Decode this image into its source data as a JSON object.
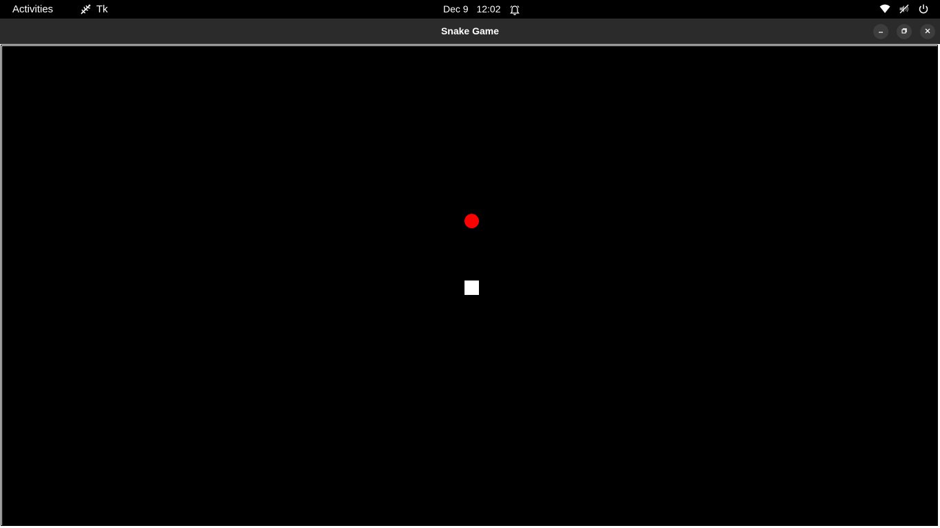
{
  "topbar": {
    "activities_label": "Activities",
    "app_name": "Tk",
    "app_icon": "tk-feather-icon",
    "date": "Dec 9",
    "time": "12:02",
    "notification_icon": "bell-icon",
    "tray_icons": [
      "wifi-icon",
      "volume-muted-icon",
      "power-icon"
    ]
  },
  "window": {
    "title": "Snake Game",
    "controls": [
      "minimize",
      "maximize",
      "close"
    ]
  },
  "game": {
    "background_color": "#000000",
    "food_color": "#ff0000",
    "snake_color": "#ffffff",
    "snake_length": 1
  }
}
